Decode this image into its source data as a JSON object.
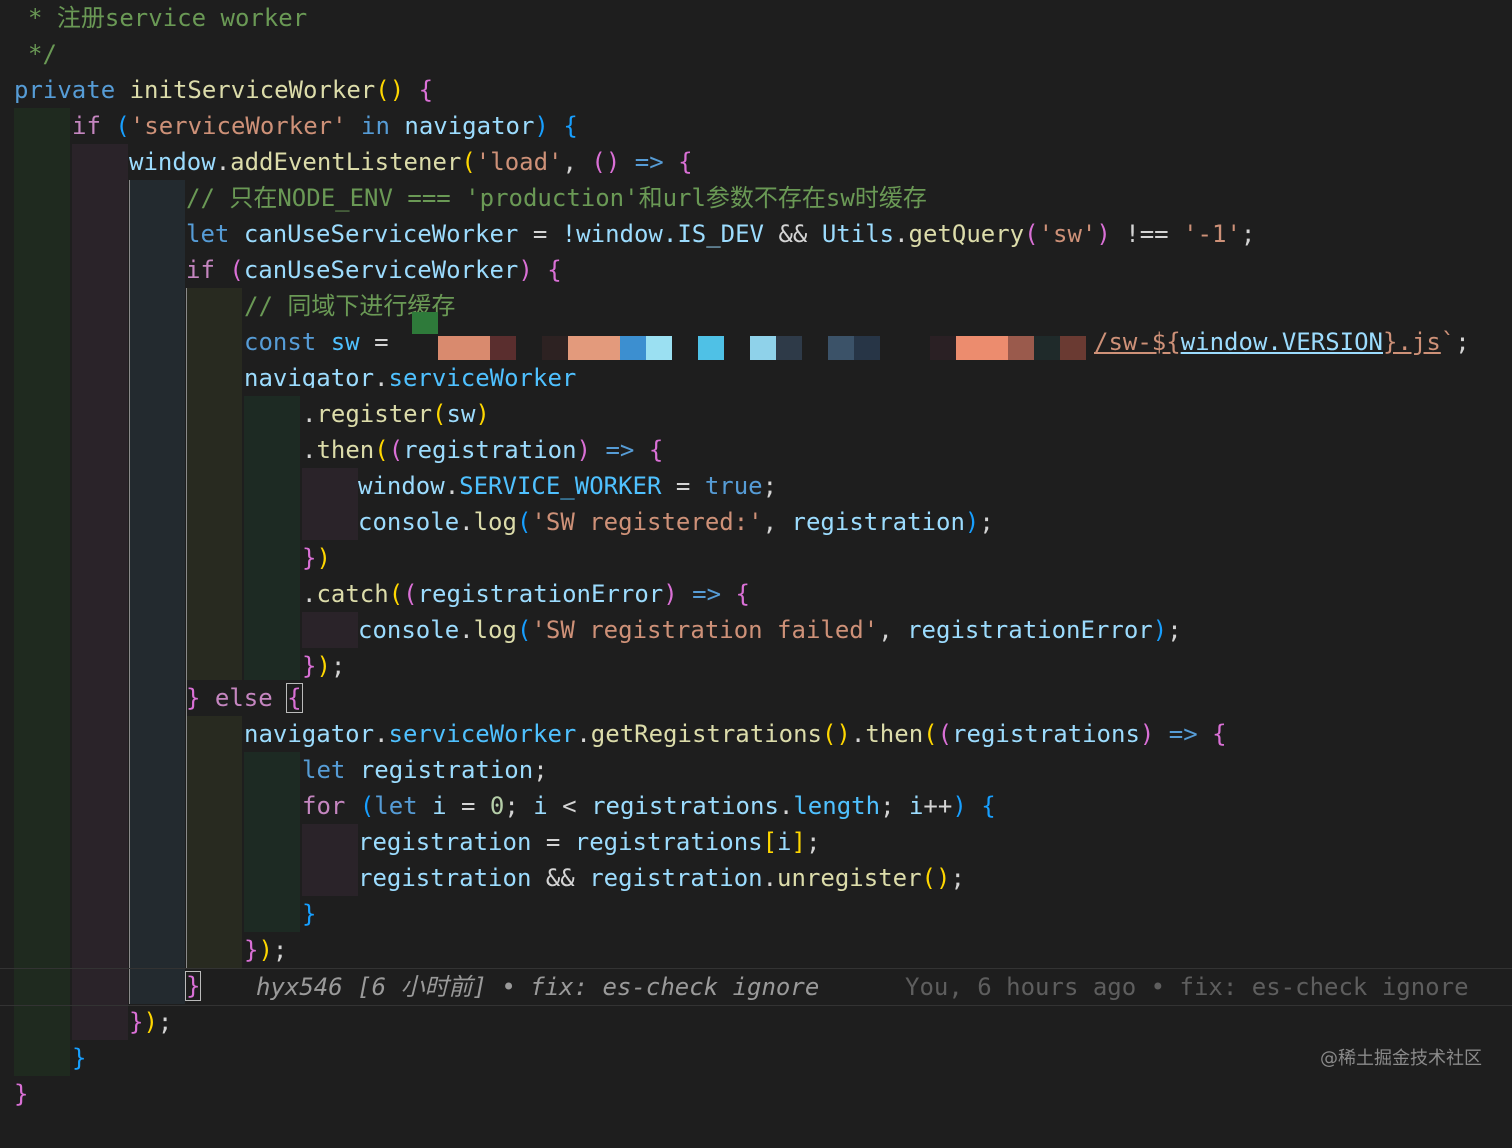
{
  "colors": {
    "background": "#1e1e1e",
    "keyword": "#569cd6",
    "control_keyword": "#c586c0",
    "function": "#dcdcaa",
    "variable": "#9cdcfe",
    "string": "#ce9178",
    "comment": "#6a9955",
    "number": "#b5cea8"
  },
  "code": {
    "comment_register": "* 注册service worker",
    "comment_end": "*/",
    "l_private": "private",
    "l_fn_name": "initServiceWorker",
    "l_if": "if",
    "l_sw_str": "'serviceWorker'",
    "l_in": "in",
    "l_navigator": "navigator",
    "l_window": "window",
    "l_addEventListener": "addEventListener",
    "l_load": "'load'",
    "comment_prod": "// 只在NODE_ENV === 'production'和url参数不存在sw时缓存",
    "l_let": "let",
    "l_canUse": "canUseServiceWorker",
    "l_is_dev": "!window.IS_DEV",
    "l_utils": "Utils",
    "l_getQuery": "getQuery",
    "l_sw_q": "'sw'",
    "l_minus1": "'-1'",
    "comment_cache": "// 同域下进行缓存",
    "l_const": "const",
    "l_sw": "sw",
    "l_sw_path_a": "/sw-${",
    "l_sw_path_b": "window.VERSION",
    "l_sw_path_c": "}.js",
    "l_nav_sw_cut": "navigator.serviceWorker",
    "l_register": "register",
    "l_then": "then",
    "l_registration": "registration",
    "l_service_worker_const": "SERVICE_WORKER",
    "l_true": "true",
    "l_console": "console",
    "l_log": "log",
    "l_sw_registered": "'SW registered:'",
    "l_catch": "catch",
    "l_registrationError": "registrationError",
    "l_sw_failed": "'SW registration failed'",
    "l_else": "else",
    "l_serviceWorker": "serviceWorker",
    "l_getRegistrations": "getRegistrations",
    "l_registrations": "registrations",
    "l_for": "for",
    "l_i": "i",
    "l_zero": "0",
    "l_length": "length",
    "l_unregister": "unregister"
  },
  "blame": {
    "inline": "hyx546 [6 小时前] • fix: es-check ignore",
    "hover": "You, 6 hours ago • fix: es-check ignore"
  },
  "watermark": "@稀土掘金技术社区"
}
